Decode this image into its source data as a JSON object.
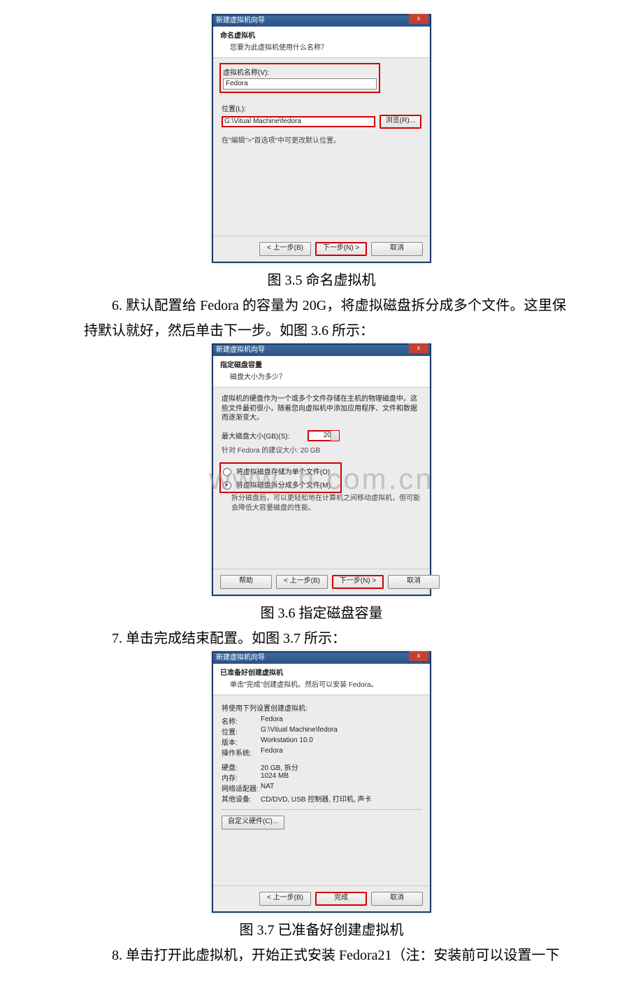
{
  "captions": {
    "c35": "图 3.5  命名虚拟机",
    "c36": "图 3.6  指定磁盘容量",
    "c37": "图 3.7  已准备好创建虚拟机"
  },
  "paragraphs": {
    "p6": "6.  默认配置给 Fedora 的容量为 20G，将虚拟磁盘拆分成多个文件。这里保持默认就好，然后单击下一步。如图 3.6 所示：",
    "p7": "7.  单击完成结束配置。如图 3.7 所示：",
    "p8": "8.  单击打开此虚拟机，开始正式安装 Fedora21（注：安装前可以设置一下"
  },
  "dlg35": {
    "title": "新建虚拟机向导",
    "close": "x",
    "h_title": "命名虚拟机",
    "h_sub": "您要为此虚拟机使用什么名称？",
    "name_label": "虚拟机名称(V):",
    "name_value": "Fedora",
    "loc_label": "位置(L):",
    "loc_value": "G:\\Vitual Machine\\fedora",
    "browse": "浏览(R)...",
    "hint": "在\"编辑\">\"首选项\"中可更改默认位置。",
    "back": "< 上一步(B)",
    "next": "下一步(N) >",
    "cancel": "取消"
  },
  "dlg36": {
    "title": "新建虚拟机向导",
    "close": "x",
    "h_title": "指定磁盘容量",
    "h_sub": "磁盘大小为多少？",
    "desc": "虚拟机的硬盘作为一个或多个文件存储在主机的物理磁盘中。这些文件最初很小，随着您向虚拟机中添加应用程序、文件和数据而逐渐变大。",
    "size_label": "最大磁盘大小(GB)(S):",
    "size_value": "20.0",
    "recommend": "针对 Fedora 的建议大小: 20 GB",
    "radio_single": "将虚拟磁盘存储为单个文件(O)",
    "radio_split": "将虚拟磁盘拆分成多个文件(M)",
    "split_hint": "拆分磁盘后，可以更轻松地在计算机之间移动虚拟机，但可能会降低大容量磁盘的性能。",
    "help": "帮助",
    "back": "< 上一步(B)",
    "next": "下一步(N) >",
    "cancel": "取消"
  },
  "dlg37": {
    "title": "新建虚拟机向导",
    "close": "x",
    "h_title": "已准备好创建虚拟机",
    "h_sub": "单击\"完成\"创建虚拟机。然后可以安装 Fedora。",
    "list_caption": "将使用下列设置创建虚拟机:",
    "rows": {
      "k_name": "名称:",
      "v_name": "Fedora",
      "k_loc": "位置:",
      "v_loc": "G:\\Vitual Machine\\fedora",
      "k_ver": "版本:",
      "v_ver": "Workstation 10.0",
      "k_os": "操作系统:",
      "v_os": "Fedora",
      "k_disk": "硬盘:",
      "v_disk": "20 GB, 拆分",
      "k_mem": "内存:",
      "v_mem": "1024 MB",
      "k_net": "网络适配器:",
      "v_net": "NAT",
      "k_other": "其他设备:",
      "v_other": "CD/DVD, USB 控制器, 打印机, 声卡"
    },
    "custom": "自定义硬件(C)...",
    "back": "< 上一步(B)",
    "finish": "完成",
    "cancel": "取消"
  }
}
